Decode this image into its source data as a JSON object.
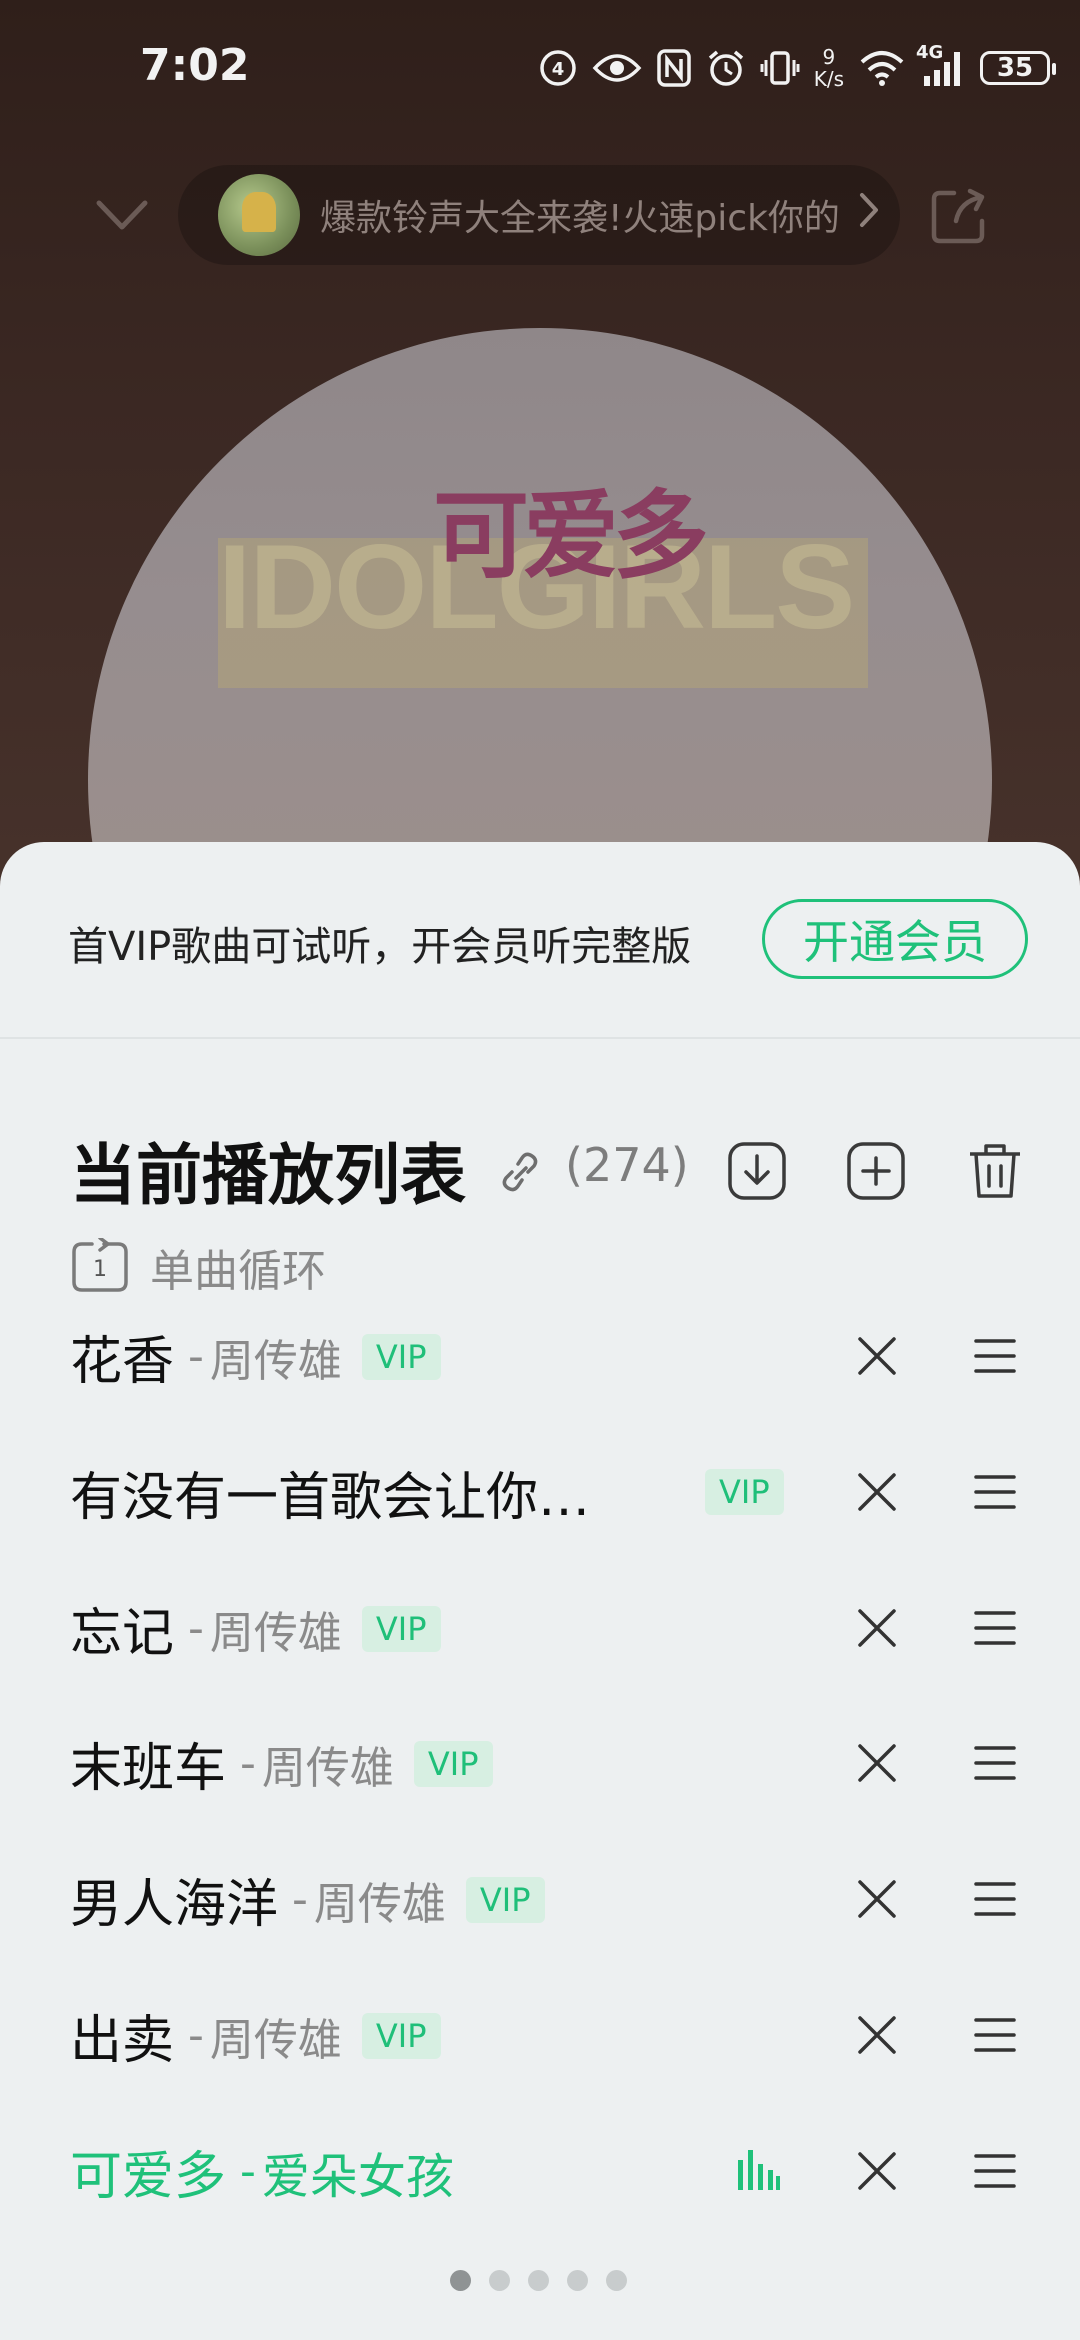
{
  "status_bar": {
    "time": "7:02",
    "net_speed_value": "9",
    "net_speed_unit": "K/s",
    "network_type": "4G",
    "battery": "35",
    "icons": [
      "hd-voice-icon",
      "eye-icon",
      "nfc-icon",
      "alarm-icon",
      "vibrate-icon",
      "wifi-icon",
      "signal-icon",
      "battery-icon"
    ]
  },
  "player_header": {
    "collapse_icon": "chevron-down-icon",
    "promo_text": "爆款铃声大全来袭!火速pick你的",
    "promo_arrow": "chevron-right-icon",
    "share_icon": "share-icon"
  },
  "cover": {
    "title_art": "可爱多",
    "deco_text": "IDOLGIRLS"
  },
  "vip_banner": {
    "message": "首VIP歌曲可试听，开会员听完整版",
    "button_label": "开通会员"
  },
  "playlist": {
    "title": "当前播放列表",
    "count": "(274)",
    "actions": [
      "link-icon",
      "download-icon",
      "add-icon",
      "trash-icon"
    ],
    "mode_label": "单曲循环",
    "songs": [
      {
        "title": "花香",
        "sep": "-",
        "artist": "周传雄",
        "tag": "VIP"
      },
      {
        "title": "有没有一首歌会让你…",
        "sep": "",
        "artist": "",
        "tag": "VIP"
      },
      {
        "title": "忘记",
        "sep": "-",
        "artist": "周传雄",
        "tag": "VIP"
      },
      {
        "title": "末班车",
        "sep": "-",
        "artist": "周传雄",
        "tag": "VIP"
      },
      {
        "title": "男人海洋",
        "sep": "-",
        "artist": "周传雄",
        "tag": "VIP"
      },
      {
        "title": "出卖",
        "sep": "-",
        "artist": "周传雄",
        "tag": "VIP"
      },
      {
        "title": "可爱多",
        "sep": "-",
        "artist": "爱朵女孩",
        "tag": "",
        "playing": true
      }
    ]
  },
  "pager": {
    "pages": 5,
    "current": 1
  },
  "colors": {
    "accent": "#1fc17a",
    "sheet_bg": "#edf0f1",
    "vip_tag_bg": "#d7efe2",
    "backdrop": "#3a2722"
  }
}
